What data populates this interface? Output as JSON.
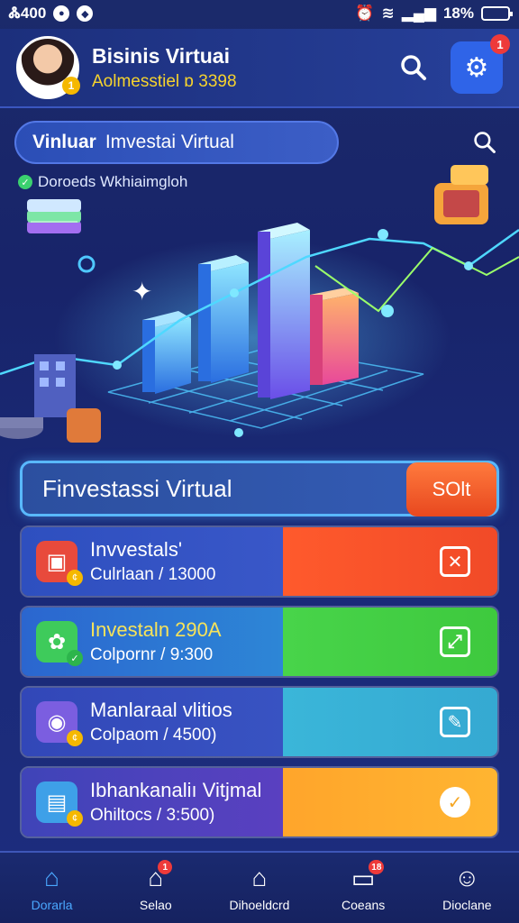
{
  "status_bar": {
    "time": "Ꮬ400",
    "battery": "18%"
  },
  "header": {
    "title": "Bisinis Virtuai",
    "subtitle": "Aolmesstiel ɒ 3398",
    "avatar_badge": "1",
    "search_icon": "search-icon",
    "settings_icon": "gear-icon",
    "settings_badge": "1"
  },
  "search": {
    "label_bold": "Vinluar",
    "label_rest": "Imvestai Virtual",
    "icon": "search-icon"
  },
  "status_line": {
    "text": "Doroeds Wkhiaimgloh"
  },
  "banner": {
    "title": "Finvestassi Virtual",
    "sort_label": "SOlt"
  },
  "cards": [
    {
      "title": "Invvestals'",
      "subtitle": "Culrlaan / 13000",
      "colors": [
        "#2e4fbf",
        "#ff5a2c"
      ],
      "icon": "briefcase-icon",
      "action_icon": "close-box-icon"
    },
    {
      "title": "Investaln 290A",
      "subtitle": "Colpornr / 9:300",
      "colors": [
        "#2b66cf",
        "#48d44a"
      ],
      "icon": "gear-check-icon",
      "action_icon": "expand-icon"
    },
    {
      "title": "Manlaraal vlitios",
      "subtitle": "Colpaom / 4500)",
      "colors": [
        "#3247b8",
        "#3ab6d9"
      ],
      "icon": "wallet-icon",
      "action_icon": "edit-icon"
    },
    {
      "title": "Ibhankanaliı Vitjmal",
      "subtitle": "Ohiltocs / 3:500)",
      "colors": [
        "#5a40c0",
        "#ffa52b"
      ],
      "icon": "card-icon",
      "action_icon": "check-round-icon"
    }
  ],
  "bottom_nav": [
    {
      "label": "Dorarla",
      "icon": "home-icon",
      "active": true
    },
    {
      "label": "Selao",
      "icon": "house-icon",
      "badge": "1"
    },
    {
      "label": "Dihoeldcrd",
      "icon": "building-icon"
    },
    {
      "label": "Coeans",
      "icon": "inbox-icon",
      "badge": "18"
    },
    {
      "label": "Dioclane",
      "icon": "user-icon"
    }
  ]
}
